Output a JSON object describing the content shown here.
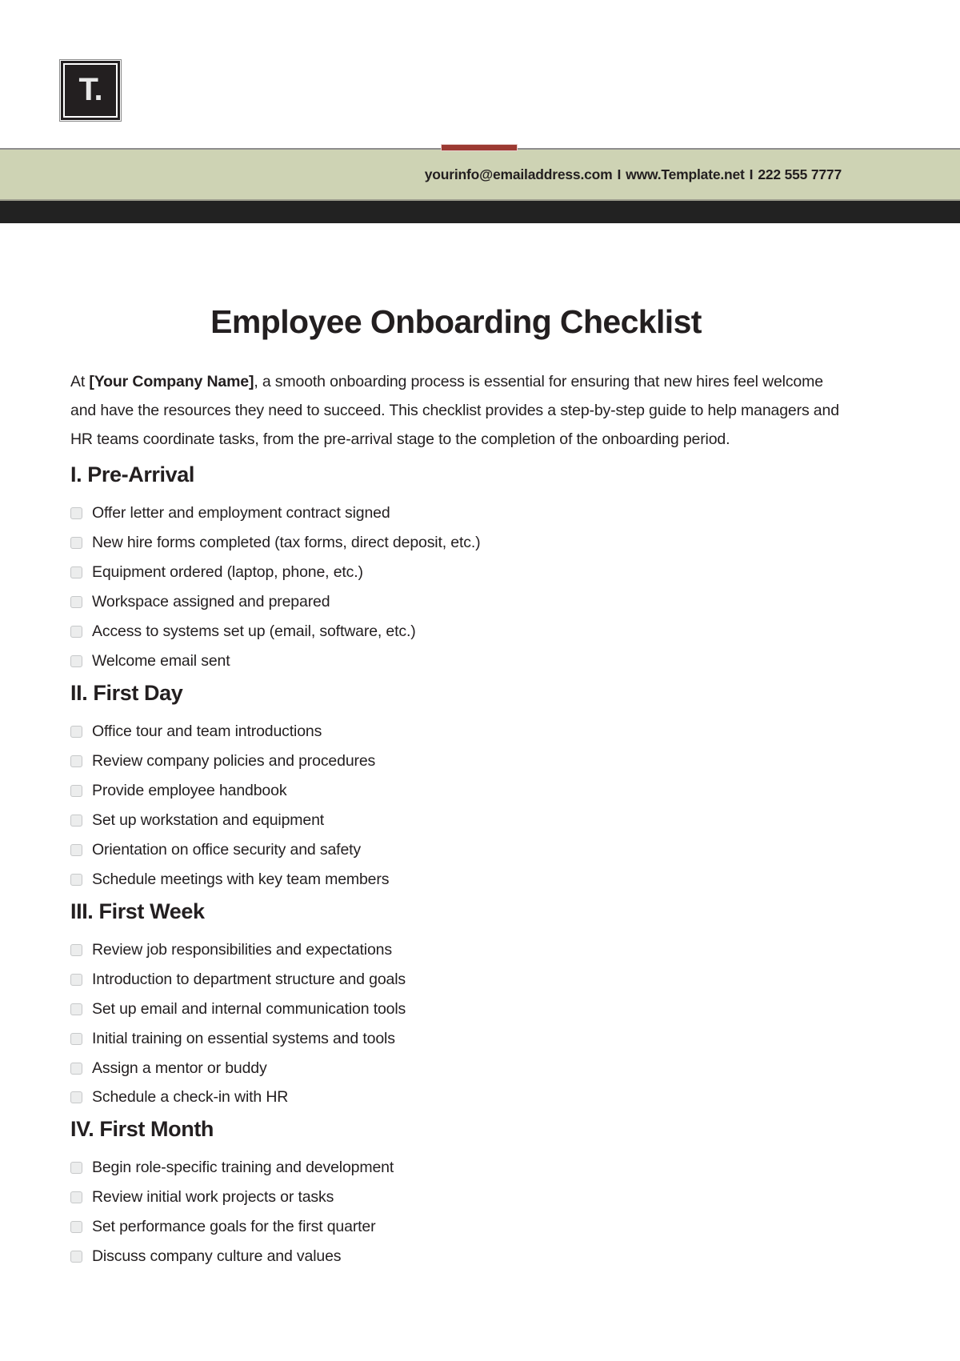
{
  "brand": {
    "logo_text": "T.",
    "logo_icon": "letter-t-period-logo",
    "accent_red": "#9c3a32",
    "band_sage": "#ced3b4",
    "band_dark": "#222222"
  },
  "header": {
    "email": "yourinfo@emailaddress.com",
    "separator_1": "I",
    "website": "www.Template.net",
    "separator_2": "I",
    "phone": "222 555 7777"
  },
  "document": {
    "title": "Employee Onboarding Checklist",
    "intro_prefix": "At ",
    "intro_company": "[Your Company Name]",
    "intro_rest": ", a smooth onboarding process is essential for ensuring that new hires feel welcome and have the resources they need to succeed. This checklist provides a step-by-step guide to help managers and HR teams coordinate tasks, from the pre-arrival stage to the completion of the onboarding period."
  },
  "sections": [
    {
      "heading": "I. Pre-Arrival",
      "items": [
        "Offer letter and employment contract signed",
        "New hire forms completed (tax forms, direct deposit, etc.)",
        "Equipment ordered (laptop, phone, etc.)",
        "Workspace assigned and prepared",
        "Access to systems set up (email, software, etc.)",
        "Welcome email sent"
      ]
    },
    {
      "heading": "II. First Day",
      "items": [
        "Office tour and team introductions",
        "Review company policies and procedures",
        "Provide employee handbook",
        "Set up workstation and equipment",
        "Orientation on office security and safety",
        "Schedule meetings with key team members"
      ]
    },
    {
      "heading": "III. First Week",
      "items": [
        "Review job responsibilities and expectations",
        "Introduction to department structure and goals",
        "Set up email and internal communication tools",
        "Initial training on essential systems and tools",
        "Assign a mentor or buddy",
        "Schedule a check-in with HR"
      ]
    },
    {
      "heading": "IV. First Month",
      "items": [
        "Begin role-specific training and development",
        "Review initial work projects or tasks",
        "Set performance goals for the first quarter",
        "Discuss company culture and values"
      ]
    }
  ]
}
